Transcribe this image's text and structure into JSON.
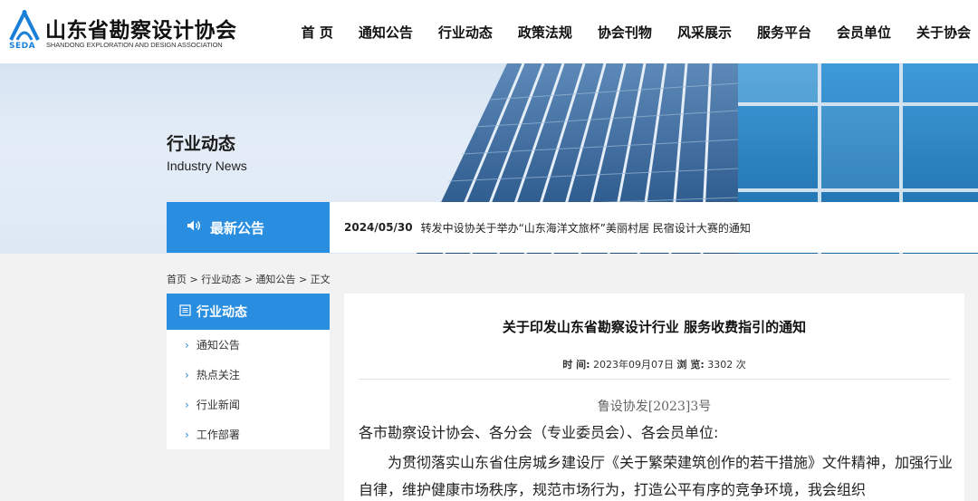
{
  "header": {
    "logo_cn": "山东省勘察设计协会",
    "logo_en": "SHANDONG EXPLORATION AND DESIGN ASSOCIATION",
    "logo_abbr": "SEDA",
    "nav": [
      "首 页",
      "通知公告",
      "行业动态",
      "政策法规",
      "协会刊物",
      "风采展示",
      "服务平台",
      "会员单位",
      "关于协会"
    ]
  },
  "banner": {
    "title": "行业动态",
    "subtitle": "Industry News"
  },
  "notice": {
    "label": "最新公告",
    "date": "2024/05/30",
    "text": "转发中设协关于举办“山东海洋文旅杯”美丽村居 民宿设计大赛的通知"
  },
  "breadcrumb": {
    "items": [
      "首页",
      "行业动态",
      "通知公告",
      "正文"
    ],
    "separator": ">"
  },
  "sidebar": {
    "title": "行业动态",
    "items": [
      "通知公告",
      "热点关注",
      "行业新闻",
      "工作部署"
    ]
  },
  "article": {
    "title": "关于印发山东省勘察设计行业 服务收费指引的通知",
    "time_label": "时 间:",
    "time_value": "2023年09月07日",
    "views_label": "浏 览:",
    "views_value": "3302 次",
    "doc_number": "鲁设协发[2023]3号",
    "salutation": "各市勘察设计协会、各分会（专业委员会）、各会员单位:",
    "body": "为贯彻落实山东省住房城乡建设厅《关于繁荣建筑创作的若干措施》文件精神，加强行业自律，维护健康市场秩序，规范市场行为，打造公平有序的竞争环境，我会组织"
  },
  "colors": {
    "accent": "#2a8ee0",
    "logo_blue": "#1a7fd6"
  }
}
